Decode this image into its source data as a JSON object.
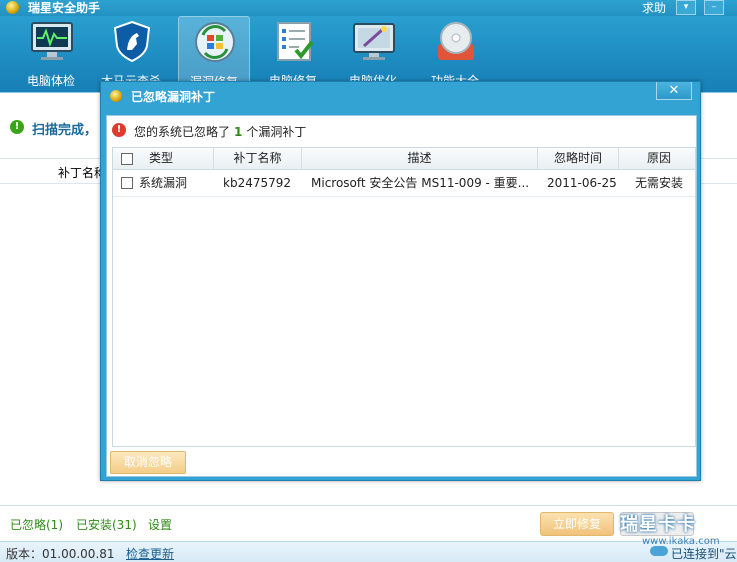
{
  "app": {
    "title": "瑞星安全助手",
    "help": "求助",
    "menu_glyph": "▾",
    "min_glyph": "–"
  },
  "toolbar": {
    "items": [
      {
        "label": "电脑体检",
        "icon": "monitor-checkup-icon"
      },
      {
        "label": "木马云查杀",
        "icon": "shield-horse-icon"
      },
      {
        "label": "漏洞修复",
        "icon": "windows-update-icon"
      },
      {
        "label": "电脑修复",
        "icon": "checklist-icon"
      },
      {
        "label": "电脑优化",
        "icon": "magic-wand-monitor-icon"
      },
      {
        "label": "功能大全",
        "icon": "disc-toolbox-icon"
      }
    ],
    "active_index": 2
  },
  "main": {
    "scan_status": "扫描完成，",
    "col_patch": "补丁名称",
    "links": [
      "已忽略(1)",
      "已安装(31)",
      "设置"
    ],
    "fix_button": "立即修复"
  },
  "status": {
    "version": "版本：01.00.00.81",
    "check_update": "检查更新",
    "connected": "已连接到\"云"
  },
  "watermark": {
    "text": "瑞星卡卡",
    "url": "www.ikaka.com"
  },
  "dialog": {
    "title": "已忽略漏洞补丁",
    "close": "✕",
    "warning_prefix": "您的系统已忽略了",
    "warning_count": "1",
    "warning_suffix": "个漏洞补丁",
    "columns": [
      "类型",
      "补丁名称",
      "描述",
      "忽略时间",
      "原因"
    ],
    "rows": [
      {
        "type": "系统漏洞",
        "patch": "kb2475792",
        "desc": "Microsoft 安全公告 MS11-009 - 重要...",
        "time": "2011-06-25",
        "reason": "无需安装"
      }
    ],
    "cancel_button": "取消忽略"
  },
  "colors": {
    "titlebar": "#2392c2",
    "dialog_frame": "#33a3d3",
    "accent_green": "#2e8a17",
    "link_blue": "#1a5e8e"
  }
}
